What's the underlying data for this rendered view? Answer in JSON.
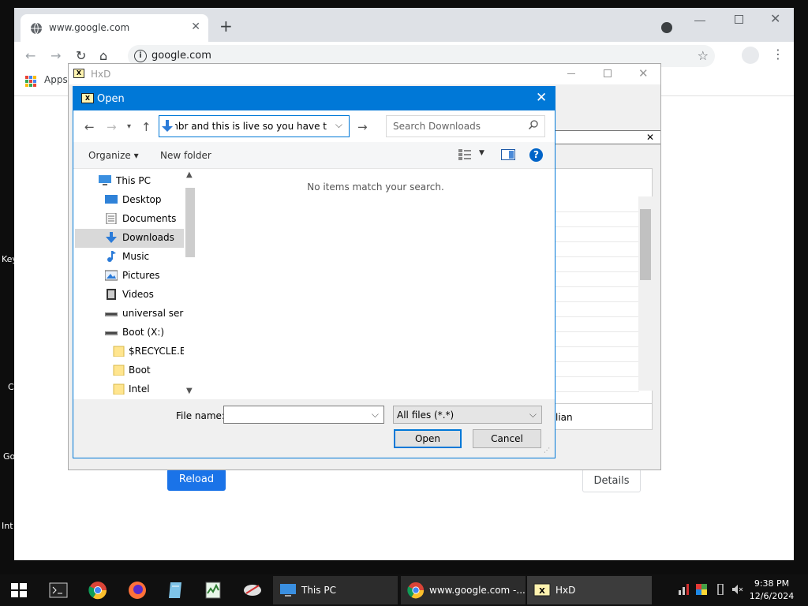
{
  "desktop": {
    "edge_labels": [
      "Key",
      "C",
      "Go",
      "Int"
    ]
  },
  "chrome": {
    "tab_title": "www.google.com",
    "url": "google.com",
    "bookmarks_apps_label": "Apps",
    "reload_label": "Reload",
    "details_label": "Details",
    "new_tab_symbol": "+",
    "tab_close_symbol": "✕"
  },
  "hxd": {
    "title": "HxD",
    "panel_text_fragment": "lian",
    "close_symbol": "✕"
  },
  "open_dialog": {
    "title": "Open",
    "address_text": "he mbr and this is live so you have t",
    "search_placeholder": "Search Downloads",
    "organize_label": "Organize ▾",
    "new_folder_label": "New folder",
    "nav_items": [
      {
        "label": "This PC",
        "icon": "this-pc-icon",
        "selected": false
      },
      {
        "label": "Desktop",
        "icon": "desktop-folder-icon",
        "selected": false
      },
      {
        "label": "Documents",
        "icon": "documents-folder-icon",
        "selected": false
      },
      {
        "label": "Downloads",
        "icon": "downloads-folder-icon",
        "selected": true
      },
      {
        "label": "Music",
        "icon": "music-folder-icon",
        "selected": false
      },
      {
        "label": "Pictures",
        "icon": "pictures-folder-icon",
        "selected": false
      },
      {
        "label": "Videos",
        "icon": "videos-folder-icon",
        "selected": false
      },
      {
        "label": "universal serial",
        "icon": "drive-icon",
        "selected": false
      },
      {
        "label": "Boot (X:)",
        "icon": "drive-icon",
        "selected": false
      },
      {
        "label": "$RECYCLE.BIN",
        "icon": "folder-icon",
        "selected": false
      },
      {
        "label": "Boot",
        "icon": "folder-icon",
        "selected": false
      },
      {
        "label": "Intel",
        "icon": "folder-icon",
        "selected": false
      }
    ],
    "empty_message": "No items match your search.",
    "file_name_label": "File name:",
    "file_name_value": "",
    "file_type_value": "All files (*.*)",
    "open_label": "Open",
    "cancel_label": "Cancel"
  },
  "taskbar": {
    "apps": [
      {
        "label": "This PC"
      },
      {
        "label": "www.google.com -..."
      },
      {
        "label": "HxD"
      }
    ],
    "time": "9:38 PM",
    "date": "12/6/2024"
  },
  "colors": {
    "accent": "#0078d7",
    "chrome_blue": "#1a73e8",
    "taskbar": "#101010"
  }
}
